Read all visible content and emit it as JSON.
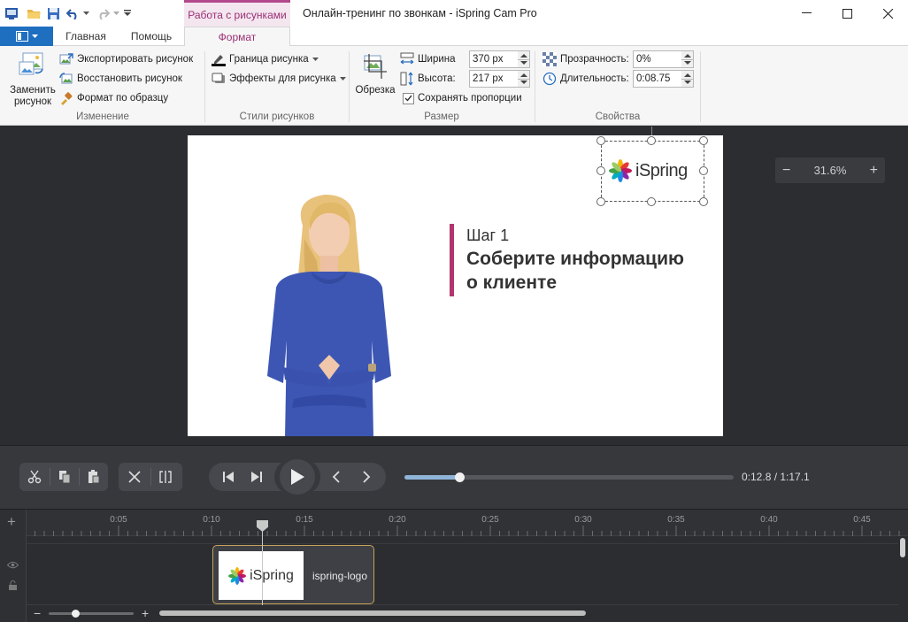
{
  "window": {
    "title": "Онлайн-тренинг по звонкам - iSpring Cam Pro",
    "context_tab": "Работа с рисунками"
  },
  "tabs": {
    "home": "Главная",
    "help": "Помощь",
    "format": "Формат"
  },
  "ribbon": {
    "change": {
      "replace_line1": "Заменить",
      "replace_line2": "рисунок",
      "export": "Экспортировать рисунок",
      "restore": "Восстановить рисунок",
      "format_painter": "Формат по образцу",
      "label": "Изменение"
    },
    "styles": {
      "border": "Граница  рисунка",
      "effects": "Эффекты для рисунка",
      "label": "Стили рисунков"
    },
    "size": {
      "crop": "Обрезка",
      "width_label": "Ширина",
      "width_value": "370 px",
      "height_label": "Высота:",
      "height_value": "217 px",
      "keep_ratio": "Сохранять пропорции",
      "label": "Размер"
    },
    "properties": {
      "opacity_label": "Прозрачность:",
      "opacity_value": "0%",
      "duration_label": "Длительность:",
      "duration_value": "0:08.75",
      "label": "Свойства"
    }
  },
  "slide": {
    "step": "Шаг 1",
    "heading_line1": "Соберите информацию",
    "heading_line2": "о клиенте",
    "logo_text": "iSpring",
    "accent_color": "#b2356f"
  },
  "zoom": {
    "minus": "−",
    "value": "31.6%",
    "plus": "+"
  },
  "player": {
    "time": "0:12.8 / 1:17.1",
    "progress": 0.166
  },
  "timeline": {
    "ticks": [
      "0:05",
      "0:10",
      "0:15",
      "0:20",
      "0:25",
      "0:30",
      "0:35",
      "0:40",
      "0:45"
    ],
    "clip_name": "ispring-logo",
    "clip_logo": "iSpring",
    "add": "+",
    "zoom_minus": "−",
    "zoom_plus": "+"
  }
}
